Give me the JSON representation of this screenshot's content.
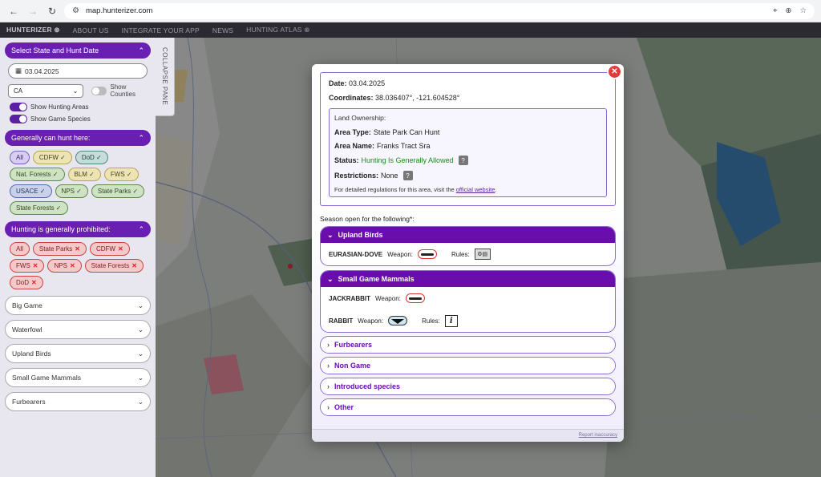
{
  "browser": {
    "url": "map.hunterizer.com",
    "back_icon": "arrow-left-icon",
    "forward_icon": "arrow-right-icon",
    "reload_icon": "reload-icon"
  },
  "appbar": {
    "brand": "HUNTERIZER ⊕",
    "links": [
      "ABOUT US",
      "INTEGRATE YOUR APP",
      "NEWS",
      "HUNTING ATLAS ⊕"
    ]
  },
  "sidebar": {
    "select_header": "Select State and Hunt Date",
    "date_value": "03.04.2025",
    "state_value": "CA",
    "show_counties": "Show Counties",
    "show_hunting_areas": "Show Hunting Areas",
    "show_game_species": "Show Game Species",
    "generally_can_hunt": "Generally can hunt here:",
    "can_hunt_chips": [
      "All",
      "CDFW ✓",
      "DoD ✓",
      "Nat. Forests ✓",
      "BLM ✓",
      "FWS ✓",
      "USACE ✓",
      "NPS ✓",
      "State Parks ✓",
      "State Forests ✓"
    ],
    "prohibited_header": "Hunting is generally prohibited:",
    "prohibited_chips": [
      "All",
      "State Parks",
      "CDFW",
      "FWS",
      "NPS",
      "State Forests",
      "DoD"
    ],
    "categories": [
      "Big Game",
      "Waterfowl",
      "Upland Birds",
      "Small Game Mammals",
      "Furbearers"
    ],
    "collapse_label": "COLLAPSE PANE"
  },
  "modal": {
    "date_label": "Date:",
    "date_value": "03.04.2025",
    "coords_label": "Coordinates:",
    "coords_value": "38.036407°, -121.604528°",
    "land_title": "Land Ownership:",
    "area_type_label": "Area Type:",
    "area_type_value": "State Park Can Hunt",
    "area_name_label": "Area Name:",
    "area_name_value": "Franks Tract Sra",
    "status_label": "Status:",
    "status_value": "Hunting Is Generally Allowed",
    "restrictions_label": "Restrictions:",
    "restrictions_value": "None",
    "reg_text": "For detailed regulations for this area, visit the",
    "reg_link": "official website",
    "reg_end": ".",
    "season_title": "Season open for the following*:",
    "upland_title": "Upland Birds",
    "upland_species": "EURASIAN-DOVE",
    "weapon_label": "Weapon:",
    "rules_label": "Rules:",
    "small_game_title": "Small Game Mammals",
    "jackrabbit": "JACKRABBIT",
    "rabbit": "RABBIT",
    "furbearers": "Furbearers",
    "non_game": "Non Game",
    "introduced": "Introduced species",
    "other": "Other",
    "report": "Report inaccuracy",
    "close_icon": "close-icon"
  }
}
